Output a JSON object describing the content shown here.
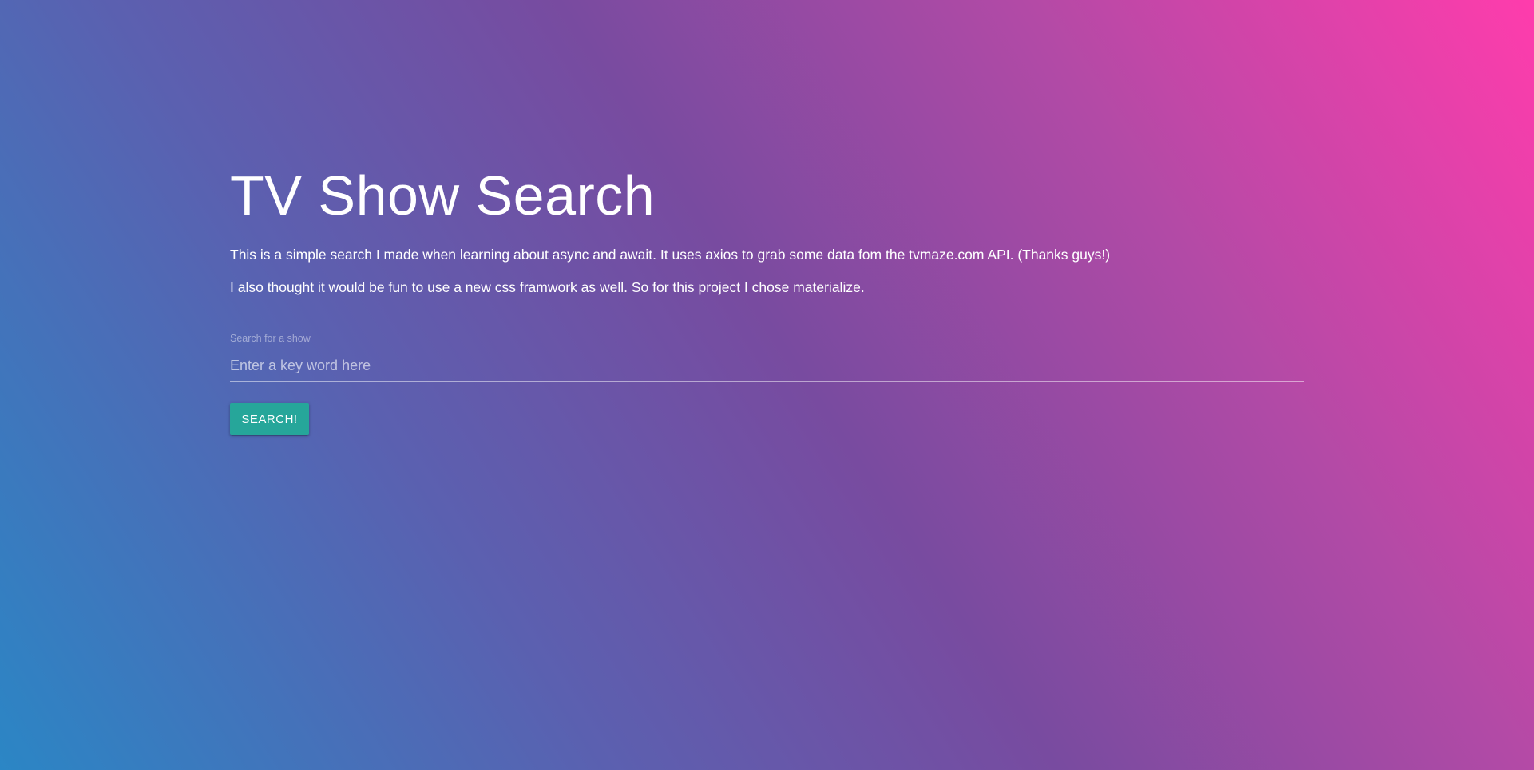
{
  "page": {
    "title": "TV Show Search",
    "intro_1": "This is a simple search I made when learning about async and await. It uses axios to grab some data fom the tvmaze.com API. (Thanks guys!)",
    "intro_2": "I also thought it would be fun to use a new css framwork as well. So for this project I chose materialize."
  },
  "search": {
    "label": "Search for a show",
    "placeholder": "Enter a key word here",
    "value": "",
    "button_label": "SEARCH!"
  },
  "colors": {
    "gradient_start": "#2b86c5",
    "gradient_mid": "#784ba0",
    "gradient_end": "#ff3cac",
    "button": "#26a69a"
  }
}
